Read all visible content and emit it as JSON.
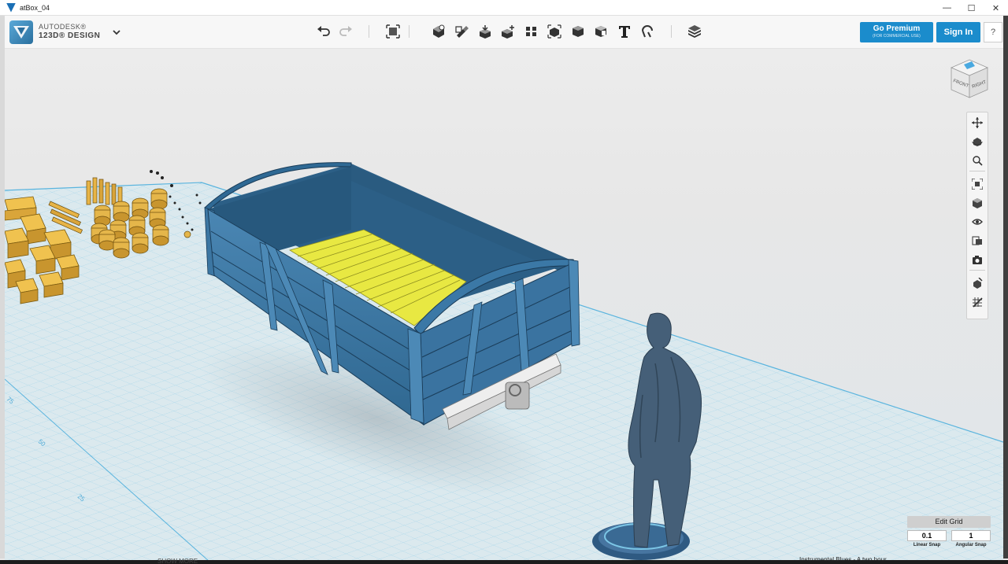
{
  "window": {
    "title": "atBox_04",
    "controls": [
      "minimize-icon",
      "maximize-icon",
      "close-icon"
    ]
  },
  "app": {
    "brand_line1": "AUTODESK®",
    "brand_line2": "123D® DESIGN",
    "menu_icon": "chevron-down-icon"
  },
  "toolbar": {
    "undo": "undo-icon",
    "redo": "redo-icon",
    "tools": [
      "transform-icon",
      "primitives-icon",
      "sketch-icon",
      "construct-icon",
      "modify-icon",
      "pattern-icon",
      "grouping-icon",
      "combine-icon",
      "measure-icon",
      "text-icon",
      "snap-icon",
      "materials-icon"
    ],
    "premium_label": "Go Premium",
    "premium_sub": "(FOR COMMERCIAL USE)",
    "signin_label": "Sign In",
    "help_label": "?"
  },
  "viewcube": {
    "front": "FRONT",
    "right": "RIGHT"
  },
  "navbar": {
    "items": [
      "pan-icon",
      "orbit-icon",
      "zoom-icon",
      "fit-icon",
      "view-mode-icon",
      "visibility-icon",
      "materials-view-icon",
      "camera-icon",
      "snap-icon",
      "grid-icon"
    ]
  },
  "grid": {
    "edit_label": "Edit Grid",
    "linear_value": "0.1",
    "angular_value": "1",
    "linear_label": "Linear Snap",
    "angular_label": "Angular Snap",
    "axis_ticks": [
      "75",
      "50",
      "25"
    ]
  },
  "taskbar": {
    "show_more": "SHOW MORE",
    "right_text": "Instrumental Blues - A two hour"
  },
  "colors": {
    "accent": "#1b8ccc",
    "wagon": "#3a73a0",
    "floor": "#e8e842",
    "grid_line": "#7cc6e6",
    "figure": "#45627c",
    "cargo": "#e5b64a"
  }
}
